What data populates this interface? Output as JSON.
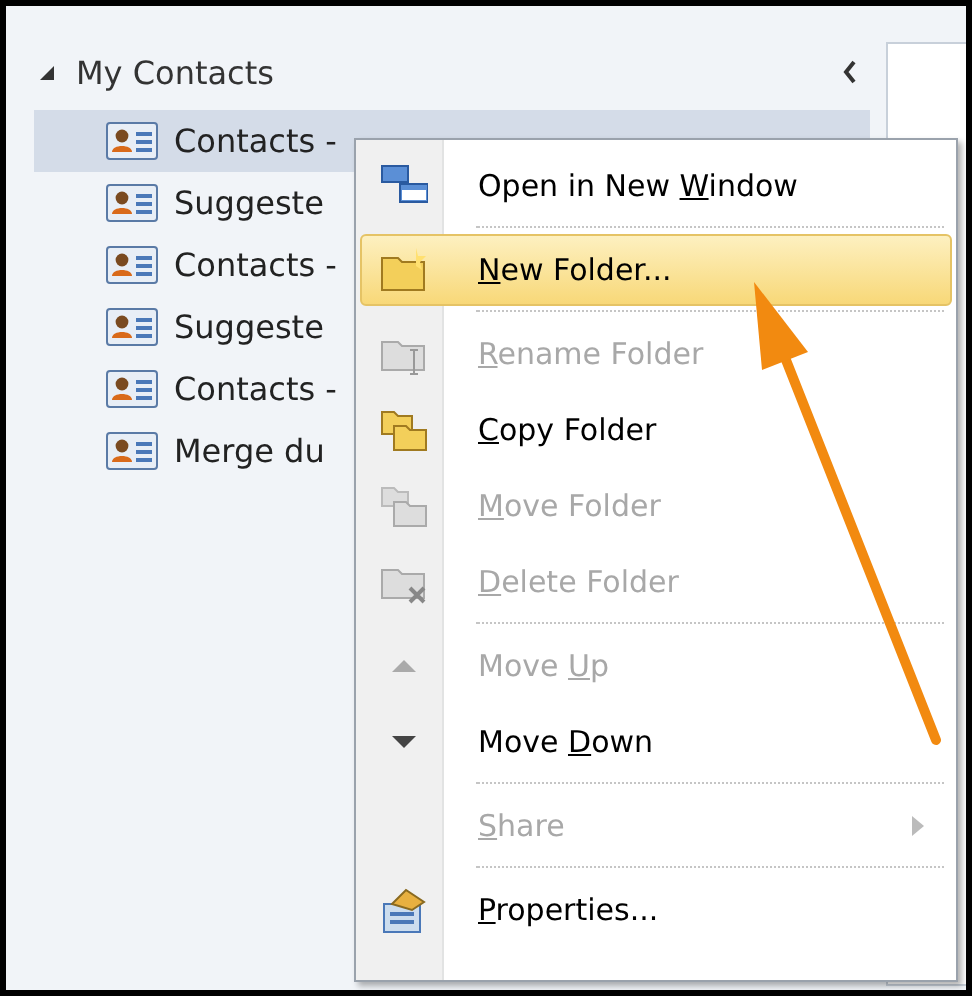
{
  "navigation_pane": {
    "heading": "My Contacts",
    "expanded": true,
    "items": [
      {
        "label": "Contacts -",
        "selected": true
      },
      {
        "label": "Suggeste",
        "selected": false
      },
      {
        "label": "Contacts -",
        "selected": false
      },
      {
        "label": "Suggeste",
        "selected": false
      },
      {
        "label": "Contacts -",
        "selected": false
      },
      {
        "label": "Merge du",
        "selected": false
      }
    ]
  },
  "context_menu": {
    "items": [
      {
        "label": {
          "before": "Open in New ",
          "key": "W",
          "after": "indow"
        },
        "disabled": false,
        "selected": false,
        "submenu": false,
        "separator_after": true
      },
      {
        "label": {
          "key": "N",
          "after": "ew Folder..."
        },
        "disabled": false,
        "selected": true,
        "submenu": false,
        "separator_after": true
      },
      {
        "label": {
          "key": "R",
          "after": "ename Folder"
        },
        "disabled": true,
        "selected": false,
        "submenu": false,
        "separator_after": false
      },
      {
        "label": {
          "key": "C",
          "after": "opy Folder"
        },
        "disabled": false,
        "selected": false,
        "submenu": false,
        "separator_after": false
      },
      {
        "label": {
          "key": "M",
          "after": "ove Folder"
        },
        "disabled": true,
        "selected": false,
        "submenu": false,
        "separator_after": false
      },
      {
        "label": {
          "key": "D",
          "after": "elete Folder"
        },
        "disabled": true,
        "selected": false,
        "submenu": false,
        "separator_after": true
      },
      {
        "label": {
          "before": "Move ",
          "key": "U",
          "after": "p"
        },
        "disabled": true,
        "selected": false,
        "submenu": false,
        "separator_after": false
      },
      {
        "label": {
          "before": "Move ",
          "key": "D",
          "after": "own"
        },
        "disabled": false,
        "selected": false,
        "submenu": false,
        "separator_after": true
      },
      {
        "label": {
          "key": "S",
          "after": "hare"
        },
        "disabled": true,
        "selected": false,
        "submenu": true,
        "separator_after": true
      },
      {
        "label": {
          "key": "P",
          "after": "roperties..."
        },
        "disabled": false,
        "selected": false,
        "submenu": false,
        "separator_after": false
      }
    ]
  }
}
